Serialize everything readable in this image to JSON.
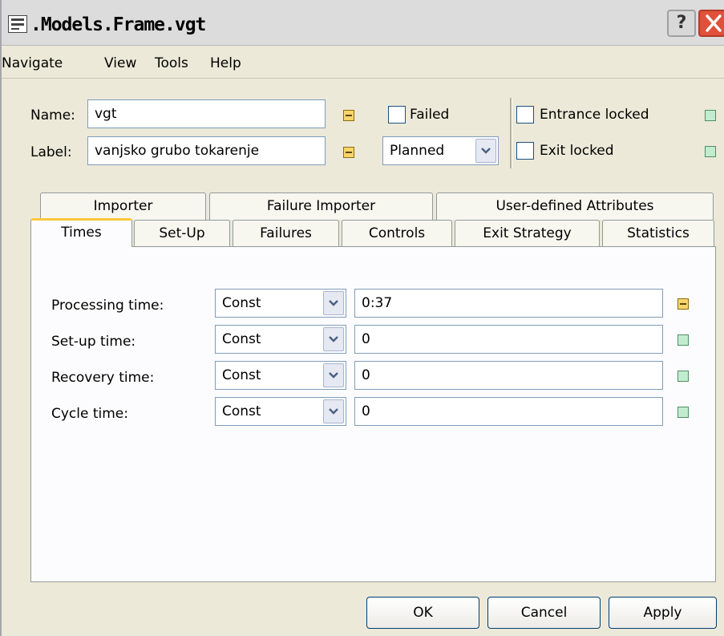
{
  "window": {
    "title": ".Models.Frame.vgt",
    "help_label": "?"
  },
  "menu": [
    "Navigate",
    "View",
    "Tools",
    "Help"
  ],
  "header": {
    "name_label": "Name:",
    "name_value": "vgt",
    "label_label": "Label:",
    "label_value": "vanjsko grubo tokarenje",
    "failed_label": "Failed",
    "state_value": "Planned",
    "entrance_locked_label": "Entrance locked",
    "exit_locked_label": "Exit locked"
  },
  "tabs_row1": [
    "Importer",
    "Failure Importer",
    "User-defined Attributes"
  ],
  "tabs_row2": [
    "Times",
    "Set-Up",
    "Failures",
    "Controls",
    "Exit Strategy",
    "Statistics"
  ],
  "times": [
    {
      "label": "Processing time:",
      "dist": "Const",
      "value": "0:37"
    },
    {
      "label": "Set-up time:",
      "dist": "Const",
      "value": "0"
    },
    {
      "label": "Recovery time:",
      "dist": "Const",
      "value": "0"
    },
    {
      "label": "Cycle time:",
      "dist": "Const",
      "value": "0"
    }
  ],
  "buttons": {
    "ok": "OK",
    "cancel": "Cancel",
    "apply": "Apply"
  },
  "colors": {
    "inherited_indicator": "#f7d56a",
    "local_indicator": "#c2ecd0",
    "active_tab_highlight": "#ffc83c"
  }
}
